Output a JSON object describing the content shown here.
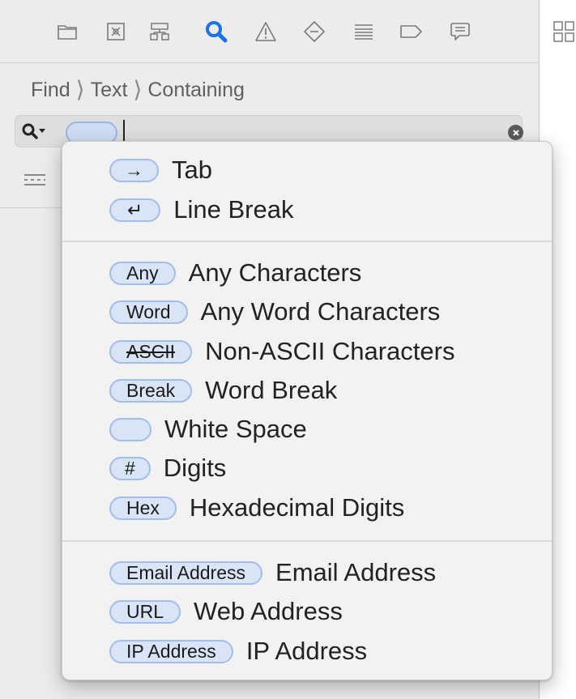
{
  "toolbar": {
    "icons": [
      "folder-icon",
      "source-control-icon",
      "hierarchy-icon",
      "search-icon",
      "warning-icon",
      "test-diamond-icon",
      "list-icon",
      "breakpoint-icon",
      "comment-icon"
    ],
    "accent": "#1a73e8"
  },
  "breadcrumb": {
    "items": [
      "Find",
      "Text",
      "Containing"
    ]
  },
  "search": {
    "value": ""
  },
  "menu": {
    "group1": [
      {
        "token": "→",
        "label": "Tab"
      },
      {
        "token": "↵",
        "label": "Line Break"
      }
    ],
    "group2": [
      {
        "token": "Any",
        "label": "Any Characters"
      },
      {
        "token": "Word",
        "label": "Any Word Characters"
      },
      {
        "token": "ASCII",
        "label": "Non-ASCII Characters"
      },
      {
        "token": "Break",
        "label": "Word Break"
      },
      {
        "token": "",
        "label": "White Space"
      },
      {
        "token": "#",
        "label": "Digits"
      },
      {
        "token": "Hex",
        "label": "Hexadecimal Digits"
      }
    ],
    "group3": [
      {
        "token": "Email Address",
        "label": "Email Address"
      },
      {
        "token": "URL",
        "label": "Web Address"
      },
      {
        "token": "IP Address",
        "label": "IP Address"
      }
    ]
  },
  "colors": {
    "token_fill": "#d9e4f7",
    "token_border": "#a3bde9",
    "panel_bg": "#ececec"
  }
}
